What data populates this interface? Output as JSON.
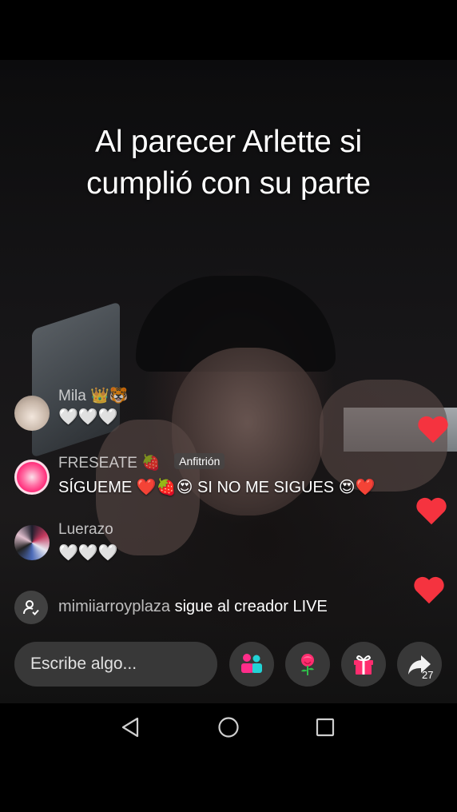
{
  "caption": {
    "line1": "Al parecer Arlette si",
    "line2": "cumplió con su parte"
  },
  "comments": [
    {
      "username": "Mila",
      "username_badge": "👑🐯",
      "text": "🤍🤍🤍",
      "avatar_icon": "user-avatar-icon"
    },
    {
      "username": "FRESEATE 🍓",
      "badge": "Anfitrión",
      "text": "SÍGUEME ❤️🍓😍 SI NO ME SIGUES 😍❤️",
      "avatar_icon": "donut-avatar-icon"
    },
    {
      "username": "Luerazo",
      "text": "🤍🤍🤍",
      "avatar_icon": "user-avatar-icon"
    }
  ],
  "follow_notice": {
    "username": "mimiiarroyplaza",
    "text": " sigue al creador LIVE"
  },
  "input": {
    "placeholder": "Escribe algo..."
  },
  "actions": {
    "share_count": "27",
    "icons": [
      "guests-icon",
      "rose-gift-icon",
      "gift-icon",
      "share-icon"
    ]
  },
  "colors": {
    "heart": "#f5333f",
    "accent_pink": "#ff2d8a",
    "accent_cyan": "#22d3d6"
  }
}
